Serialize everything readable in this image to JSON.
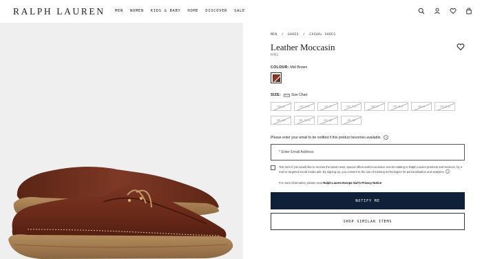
{
  "header": {
    "logo": "RALPH LAUREN",
    "nav": [
      "MEN",
      "WOMEN",
      "KIDS & BABY",
      "HOME",
      "DISCOVER",
      "SALE"
    ],
    "icons": [
      "search-icon",
      "account-icon",
      "wishlist-icon",
      "bag-icon"
    ]
  },
  "breadcrumb": [
    "MEN",
    "/",
    "SHOES",
    "/",
    "CASUAL SHOES"
  ],
  "product": {
    "title": "Leather Moccasin",
    "brand": "RRL",
    "colour_label": "COLOUR:",
    "colour_value": "Mid Brown",
    "size_label": "SIZE:",
    "size_chart": "Size Chart",
    "sizes": [
      "UK 6",
      "UK 6.5",
      "UK 7",
      "UK 7.5",
      "UK 8",
      "UK 8.5",
      "UK 9",
      "UK 9.5",
      "UK 10",
      "UK 10.5",
      "UK 11",
      "UK 12"
    ]
  },
  "notify": {
    "prompt": "Please enter your email to be notified if this product becomes available.",
    "email_placeholder": "* Enter Email Address",
    "consent_text": "Tick here if you would like to receive the latest news, special offers and/or exclusive events relating to Ralph Lauren products and services, by e-mail or targeted social media ads. By signing up, you consent to the use of tracking technologies for personalisation and analytics.",
    "more_info_prefix": "For more information, please read",
    "privacy_link": "Ralph Lauren Europe Sàrl’s Privacy Notice",
    "notify_button": "NOTIFY ME",
    "similar_button": "SHOP SIMILAR ITEMS"
  },
  "colors": {
    "notify_button_bg": "#0f2039",
    "image_bg": "#f0eff0"
  }
}
